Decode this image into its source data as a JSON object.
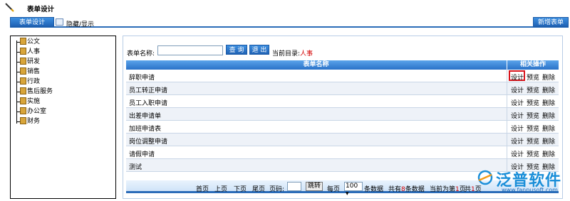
{
  "window": {
    "title": "表单设计"
  },
  "toolbar": {
    "design_label": "表单设计",
    "hide_show_label": "隐藏/显示",
    "new_form_label": "新增表单"
  },
  "tree": {
    "items": [
      "公文",
      "人事",
      "研发",
      "销售",
      "行政",
      "售后服务",
      "实施",
      "办公室",
      "财务"
    ]
  },
  "filter": {
    "form_name_label": "表单名称:",
    "form_name_value": "",
    "query_label": "查 询",
    "exit_label": "退 出",
    "current_dir_label": "当前目录:",
    "current_dir_value": "人事"
  },
  "table": {
    "headers": [
      "表单名称",
      "相关操作"
    ],
    "rows": [
      "辞职申请",
      "员工转正申请",
      "员工入职申请",
      "出差申请单",
      "加班申请表",
      "岗位调整申请",
      "请假申请",
      "测试"
    ],
    "ops": {
      "design": "设计",
      "preview": "预览",
      "delete": "删除"
    }
  },
  "pager": {
    "first": "首页",
    "prev": "上页",
    "next": "下页",
    "last": "尾页",
    "page_code_label": "页码:",
    "jump_label": "跳转",
    "per_page_label": "每页",
    "per_page_value": "100",
    "records_label": "条数据",
    "total_prefix": "共有",
    "total_count": "8",
    "total_suffix": "条数据",
    "current_prefix": "当前为第",
    "current_page": "1",
    "current_suffix": "页",
    "pages_prefix": "共",
    "pages_count": "1",
    "pages_suffix": "页"
  },
  "watermark": {
    "brand": "泛普软件",
    "url": "www.fanpusoft.com"
  },
  "colors": {
    "accent": "#2b6cb8",
    "highlight": "#d8141c",
    "current_dir": "#d40000"
  }
}
